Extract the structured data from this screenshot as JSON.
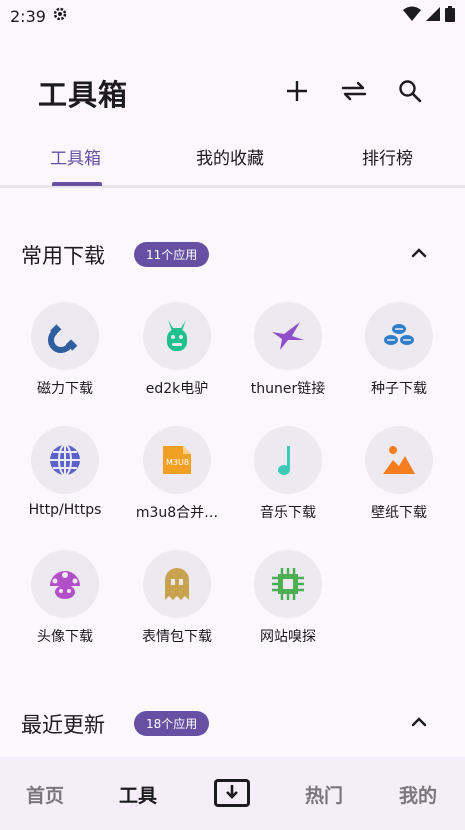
{
  "status_bar": {
    "time": "2:39",
    "icons": [
      "gear-icon",
      "wifi-icon",
      "signal-icon",
      "battery-icon"
    ]
  },
  "header": {
    "title": "工具箱",
    "actions": [
      "add-icon",
      "swap-icon",
      "search-icon"
    ]
  },
  "tabs": [
    {
      "label": "工具箱",
      "active": true
    },
    {
      "label": "我的收藏",
      "active": false
    },
    {
      "label": "排行榜",
      "active": false
    }
  ],
  "sections": [
    {
      "title": "常用下载",
      "badge": "11个应用"
    },
    {
      "title": "最近更新",
      "badge": "18个应用"
    }
  ],
  "apps": [
    {
      "label": "磁力下载",
      "icon": "magnet-icon",
      "color": "#2f5f9e"
    },
    {
      "label": "ed2k电驴",
      "icon": "donkey-icon",
      "color": "#1ec08c"
    },
    {
      "label": "thuner链接",
      "icon": "bird-icon",
      "color": "#8e4fc9"
    },
    {
      "label": "种子下载",
      "icon": "seeds-icon",
      "color": "#2e7fc9"
    },
    {
      "label": "Http/Https",
      "icon": "globe-icon",
      "color": "#5b62c9"
    },
    {
      "label": "m3u8合并…",
      "icon": "m3u8-file-icon",
      "color": "#f2a024"
    },
    {
      "label": "音乐下载",
      "icon": "music-note-icon",
      "color": "#3cc9b8"
    },
    {
      "label": "壁纸下载",
      "icon": "wallpaper-icon",
      "color": "#f57c1f"
    },
    {
      "label": "头像下载",
      "icon": "mushroom-icon",
      "color": "#b24fc9"
    },
    {
      "label": "表情包下载",
      "icon": "ghost-icon",
      "color": "#c9a24f"
    },
    {
      "label": "网站嗅探",
      "icon": "chip-icon",
      "color": "#4caf50"
    }
  ],
  "bottom_nav": [
    {
      "label": "首页",
      "active": false
    },
    {
      "label": "工具",
      "active": true
    },
    {
      "label": "",
      "icon": "download-box-icon"
    },
    {
      "label": "热门",
      "active": false
    },
    {
      "label": "我的",
      "active": false
    }
  ],
  "colors": {
    "accent": "#6750a4",
    "background": "#fbf7fd",
    "icon_circle": "#ede9f1"
  }
}
